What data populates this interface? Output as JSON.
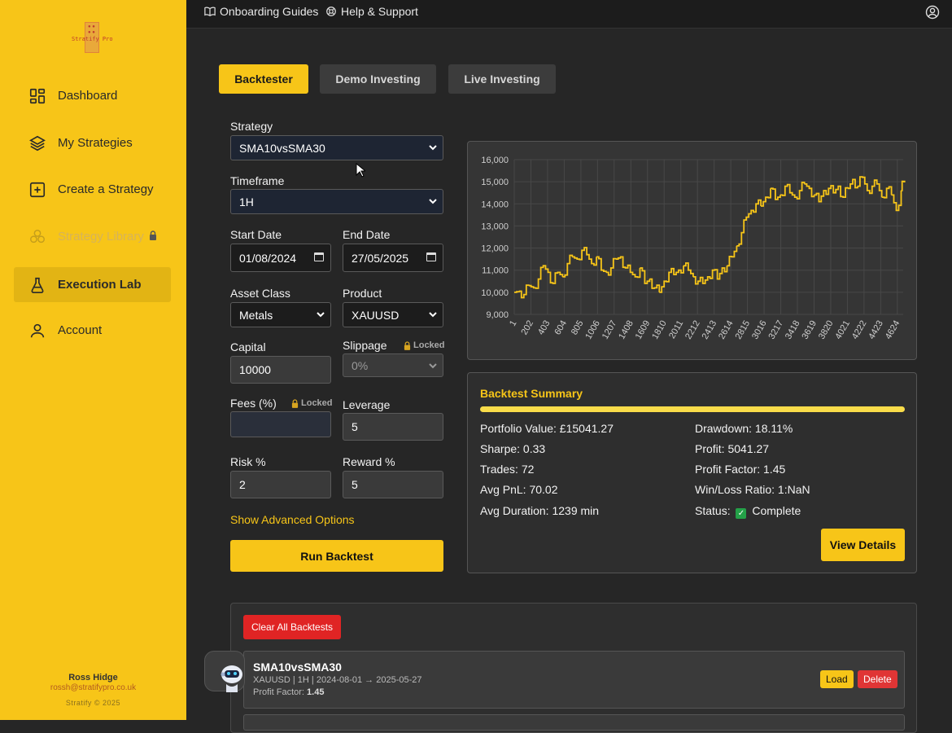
{
  "brand": {
    "logo_text": "Stratify Pro",
    "logo_dots": "● ●\n● ●"
  },
  "sidebar": {
    "items": [
      {
        "label": "Dashboard",
        "icon": "grid-icon"
      },
      {
        "label": "My Strategies",
        "icon": "layers-icon"
      },
      {
        "label": "Create a Strategy",
        "icon": "plus-square-icon"
      },
      {
        "label": "Strategy Library",
        "icon": "circles-icon",
        "locked": true
      },
      {
        "label": "Execution Lab",
        "icon": "flask-icon",
        "active": true
      },
      {
        "label": "Account",
        "icon": "user-icon"
      }
    ],
    "user_name": "Ross Hidge",
    "user_email": "rossh@stratifypro.co.uk",
    "copyright": "Stratify © 2025"
  },
  "topbar": {
    "guides": "Onboarding Guides",
    "support": "Help & Support"
  },
  "tabs": [
    {
      "label": "Backtester",
      "active": true
    },
    {
      "label": "Demo Investing"
    },
    {
      "label": "Live Investing"
    }
  ],
  "form": {
    "strategy_label": "Strategy",
    "strategy_value": "SMA10vsSMA30",
    "timeframe_label": "Timeframe",
    "timeframe_value": "1H",
    "start_label": "Start Date",
    "start_value": "01/08/2024",
    "end_label": "End Date",
    "end_value": "27/05/2025",
    "asset_label": "Asset Class",
    "asset_value": "Metals",
    "product_label": "Product",
    "product_value": "XAUUSD",
    "capital_label": "Capital",
    "capital_value": "10000",
    "slippage_label": "Slippage",
    "slippage_value": "0%",
    "fees_label": "Fees (%)",
    "fees_value": "",
    "leverage_label": "Leverage",
    "leverage_value": "5",
    "risk_label": "Risk %",
    "risk_value": "2",
    "reward_label": "Reward %",
    "reward_value": "5",
    "locked_text": "Locked",
    "advanced": "Show Advanced Options",
    "run": "Run Backtest"
  },
  "chart_data": {
    "type": "line",
    "title": "",
    "xlabel": "",
    "ylabel": "",
    "x_ticks": [
      "1",
      "202",
      "403",
      "604",
      "805",
      "1006",
      "1207",
      "1408",
      "1609",
      "1810",
      "2011",
      "2212",
      "2413",
      "2614",
      "2815",
      "3016",
      "3217",
      "3418",
      "3619",
      "3820",
      "4021",
      "4222",
      "4423",
      "4624"
    ],
    "y_ticks": [
      9000,
      10000,
      11000,
      12000,
      13000,
      14000,
      15000,
      16000
    ],
    "ylim": [
      9000,
      16000
    ],
    "xlim": [
      1,
      4826
    ],
    "grid": true,
    "color": "#f7c518",
    "series": [
      {
        "x": [
          1,
          60,
          120,
          180,
          240,
          300,
          360,
          420,
          480,
          540,
          600,
          660,
          720,
          780,
          840,
          900,
          960,
          1020,
          1080,
          1140,
          1200,
          1260,
          1320,
          1380,
          1440,
          1500,
          1560,
          1620,
          1680,
          1740,
          1800,
          1860,
          1920,
          1980,
          2040,
          2100,
          2160,
          2220,
          2280,
          2340,
          2400,
          2460,
          2520,
          2580,
          2640,
          2700,
          2760,
          2820,
          2880,
          2940,
          3000,
          3060,
          3120,
          3180,
          3240,
          3300,
          3360,
          3420,
          3480,
          3540,
          3600,
          3660,
          3720,
          3780,
          3840,
          3900,
          3960,
          4020,
          4080,
          4140,
          4200,
          4260,
          4320,
          4380,
          4440,
          4500,
          4560,
          4620,
          4680,
          4740,
          4800,
          4826
        ],
        "y": [
          10000,
          10050,
          9900,
          10300,
          10200,
          10600,
          11200,
          10900,
          10400,
          10900,
          10700,
          11300,
          11600,
          11500,
          11900,
          11700,
          11300,
          11600,
          11000,
          10900,
          11100,
          11500,
          11600,
          11100,
          10900,
          10700,
          11100,
          10400,
          10600,
          10200,
          10000,
          10500,
          10900,
          10800,
          11000,
          11200,
          11000,
          10700,
          10500,
          10400,
          10700,
          11000,
          10600,
          11100,
          11200,
          11600,
          12100,
          12700,
          13400,
          13700,
          14000,
          13900,
          14300,
          14700,
          14200,
          14400,
          14800,
          14500,
          14300,
          14600,
          14900,
          14700,
          14400,
          14100,
          14600,
          14700,
          14500,
          14800,
          14300,
          14700,
          15100,
          14800,
          15200,
          14600,
          14800,
          14900,
          14300,
          14700,
          14400,
          13700,
          14600,
          15000
        ]
      }
    ]
  },
  "summary": {
    "title": "Backtest Summary",
    "portfolio": "Portfolio Value: £15041.27",
    "sharpe": "Sharpe: 0.33",
    "trades": "Trades: 72",
    "avg_pnl": "Avg PnL: 70.02",
    "avg_dur": "Avg Duration: 1239 min",
    "drawdown": "Drawdown: 18.11%",
    "profit": "Profit: 5041.27",
    "profit_factor": "Profit Factor: 1.45",
    "winloss": "Win/Loss Ratio: 1:NaN",
    "status_label": "Status:",
    "status_value": "Complete",
    "view": "View Details"
  },
  "history": {
    "clear": "Clear All Backtests",
    "rows": [
      {
        "name": "SMA10vsSMA30",
        "meta": "XAUUSD | 1H | 2024-08-01 → 2025-05-27",
        "pf_label": "Profit Factor:",
        "pf_value": "1.45",
        "load": "Load",
        "delete": "Delete"
      }
    ]
  }
}
